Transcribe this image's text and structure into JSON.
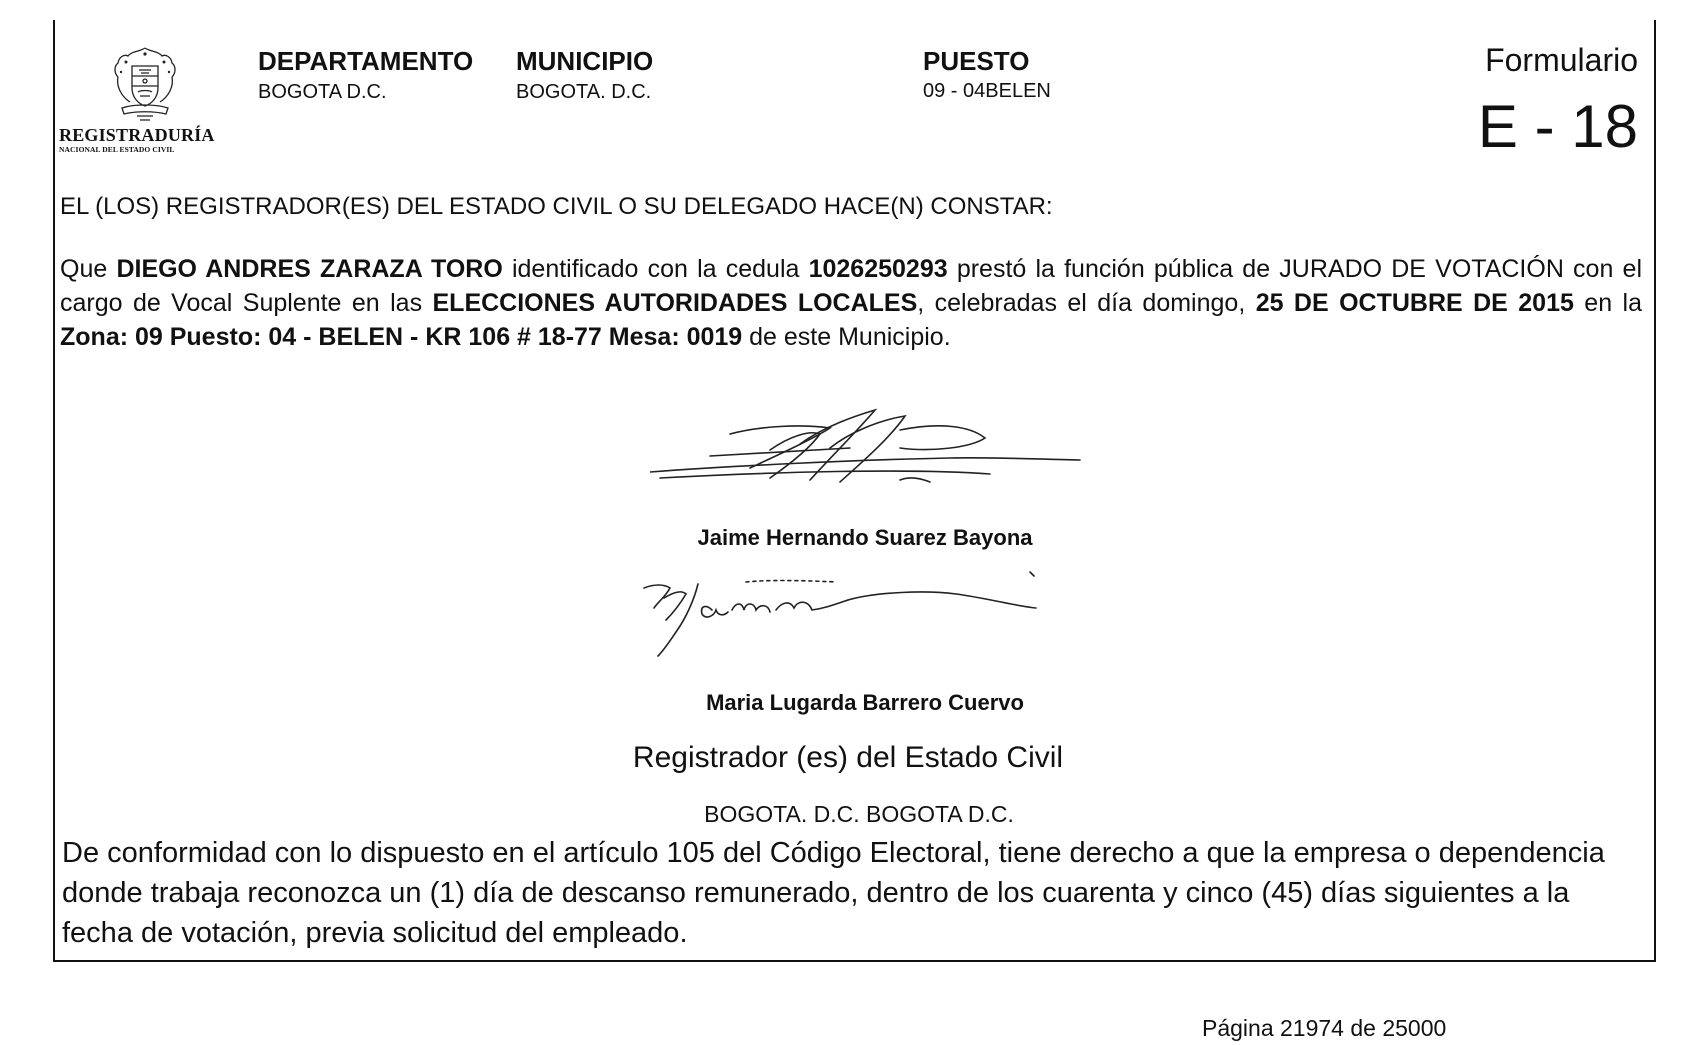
{
  "logo": {
    "title": "REGISTRADURÍA",
    "subtitle": "NACIONAL DEL ESTADO CIVIL",
    "icon": "coat-of-arms-icon"
  },
  "header": {
    "departamento_label": "DEPARTAMENTO",
    "departamento_value": "BOGOTA D.C.",
    "municipio_label": "MUNICIPIO",
    "municipio_value": "BOGOTA. D.C.",
    "puesto_label": "PUESTO",
    "puesto_value": "09 - 04BELEN",
    "formulario_label": "Formulario",
    "formulario_code": "E - 18"
  },
  "constar": "EL (LOS) REGISTRADOR(ES) DEL ESTADO CIVIL O SU DELEGADO HACE(N) CONSTAR:",
  "body": {
    "p1": "Que ",
    "name": "DIEGO ANDRES ZARAZA TORO",
    "p2": " identificado con la cedula ",
    "cedula": "1026250293",
    "p3": " prestó la función pública de JURADO DE VOTACIÓN con el cargo de Vocal Suplente en las ",
    "eleccion": "ELECCIONES AUTORIDADES LOCALES",
    "p4": ", celebradas el día domingo, ",
    "fecha": "25 DE OCTUBRE DE 2015",
    "p5": "  en la ",
    "ubicacion": "Zona: 09 Puesto: 04 - BELEN - KR 106 # 18-77 Mesa: 0019",
    "p6": " de este Municipio."
  },
  "signatories": [
    {
      "name": "Jaime Hernando Suarez Bayona"
    },
    {
      "name": "Maria Lugarda Barrero Cuervo"
    }
  ],
  "registrador_title": "Registrador (es) del Estado Civil",
  "city_line": "BOGOTA. D.C.  BOGOTA D.C.",
  "conformidad": "De conformidad con lo dispuesto en el artículo 105 del Código Electoral, tiene derecho a que la empresa o dependencia donde trabaja reconozca un (1) día de descanso remunerado, dentro de los cuarenta y cinco (45) días siguientes a la fecha de votación, previa solicitud del empleado.",
  "pagina": "Página  21974 de 25000"
}
